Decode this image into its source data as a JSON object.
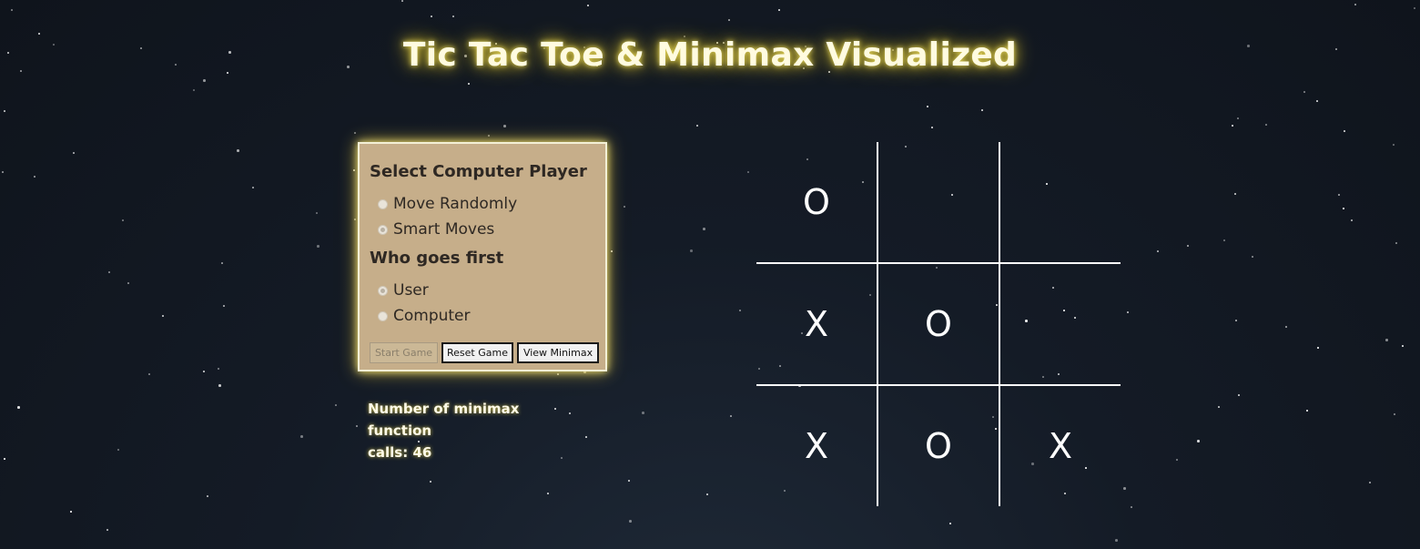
{
  "page": {
    "title": "Tic Tac Toe & Minimax Visualized"
  },
  "settings": {
    "computer_player_heading": "Select Computer Player",
    "computer_player_options": [
      "Move Randomly",
      "Smart Moves"
    ],
    "computer_player_selected": "Smart Moves",
    "first_player_heading": "Who goes first",
    "first_player_options": [
      "User",
      "Computer"
    ],
    "first_player_selected": "User",
    "buttons": {
      "start": "Start Game",
      "reset": "Reset Game",
      "view_minimax": "View Minimax"
    },
    "start_disabled": true
  },
  "stats": {
    "minimax_calls_line1": "Number of minimax function",
    "minimax_calls_line2": "calls: 46"
  },
  "board": {
    "cells": [
      "O",
      "",
      "",
      "X",
      "O",
      "",
      "X",
      "O",
      "X"
    ]
  },
  "colors": {
    "panel_background": "#c6ae8a",
    "title_glow": "#e3d45a",
    "board_lines": "#ffffff"
  }
}
